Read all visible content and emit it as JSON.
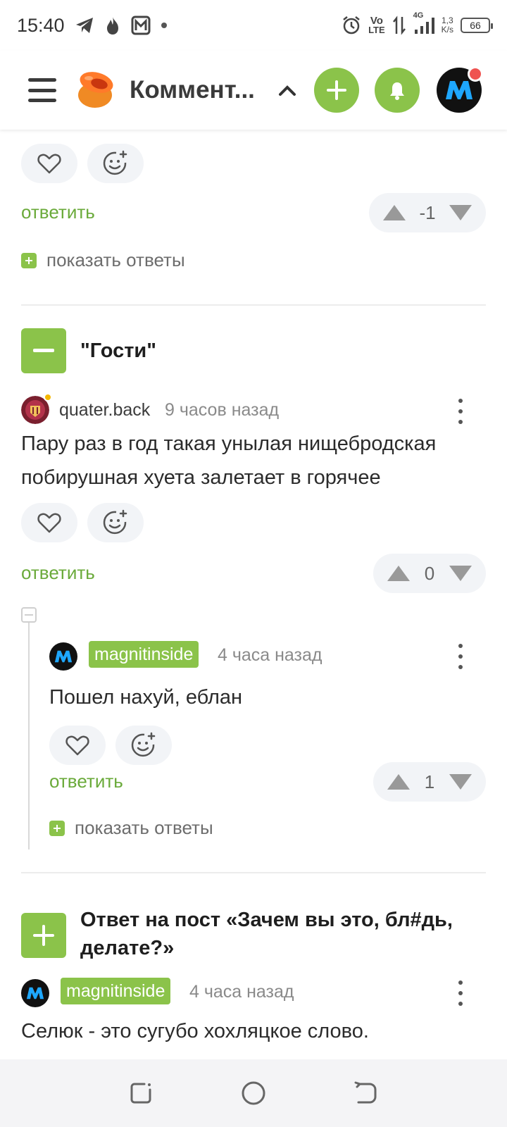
{
  "status_bar": {
    "time": "15:40",
    "network_speed_value": "1,3",
    "network_speed_unit": "K/s",
    "volte_top": "Vo",
    "volte_bottom": "LTE",
    "network_type": "4G",
    "battery": "66"
  },
  "app_bar": {
    "title": "Коммент...",
    "accent_color": "#8bc34a"
  },
  "comment_top": {
    "reply_label": "ответить",
    "score": "-1",
    "show_replies_label": "показать ответы"
  },
  "thread_1": {
    "group_title": "\"Гости\"",
    "comment": {
      "username": "quater.back",
      "time_ago": "9 часов назад",
      "text": "Пару раз в год такая унылая нищебродская побирушная хуета залетает в горячее",
      "reply_label": "ответить",
      "score": "0"
    },
    "reply": {
      "username": "magnitinside",
      "time_ago": "4 часа назад",
      "text": "Пошел нахуй, еблан",
      "reply_label": "ответить",
      "score": "1",
      "show_replies_label": "показать ответы"
    }
  },
  "thread_2": {
    "group_title": "Ответ на пост «Зачем вы это, бл#дь, делате?»",
    "comment": {
      "username": "magnitinside",
      "time_ago": "4 часа назад",
      "text": "Селюк - это сугубо хохляцкое слово."
    }
  }
}
